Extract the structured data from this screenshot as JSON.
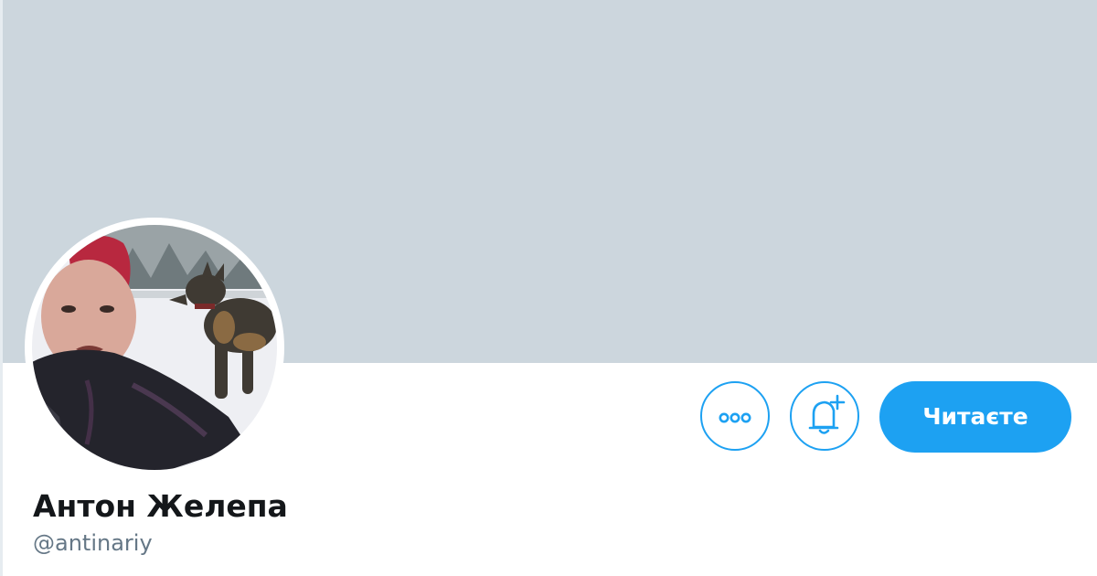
{
  "profile": {
    "display_name": "Антон Желепа",
    "handle": "@antinariy",
    "avatar_icon": "profile-photo",
    "banner_color": "#ccd6dd"
  },
  "actions": {
    "more_icon": "more-dots-icon",
    "notifications_icon": "bell-plus-icon",
    "follow_label": "Читаєте",
    "accent_color": "#1da1f2"
  }
}
